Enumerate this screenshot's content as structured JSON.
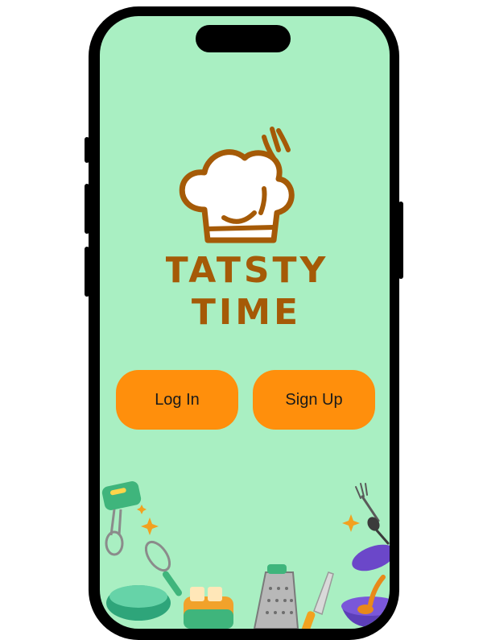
{
  "app": {
    "logo_line1": "TATSTY",
    "logo_line2": "TIME"
  },
  "auth": {
    "login_label": "Log In",
    "signup_label": "Sign Up"
  },
  "colors": {
    "background": "#a9efc2",
    "button": "#ff8f0c",
    "logo": "#a55a07"
  },
  "decorations": [
    "hand-mixer-icon",
    "whisk-icon",
    "bowl-icon",
    "toaster-icon",
    "grater-icon",
    "knife-icon",
    "fork-icon",
    "spoon-icon",
    "pot-icon",
    "sparkle-icon"
  ]
}
